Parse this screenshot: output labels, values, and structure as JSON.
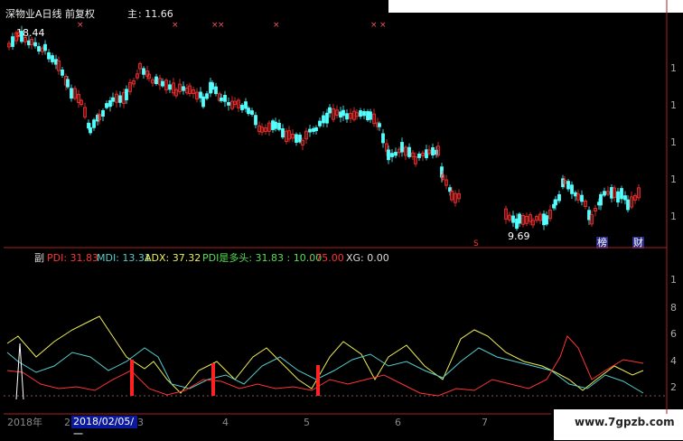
{
  "header": {
    "title": "深物业A日线 前复权",
    "ma_label": "主",
    "ma_value": ": 11.66",
    "high_label": "18.44",
    "low_label": "9.69"
  },
  "markers": {
    "s_label": "S",
    "ban_label": "榜",
    "cai_label": "财",
    "x_mark": "×"
  },
  "price_scale": [
    "1",
    "1",
    "1",
    "1",
    "1",
    "1"
  ],
  "indicator": {
    "name": "副",
    "pdi": "PDI: 31.83",
    "mdi": "MDI: 13.31",
    "adx": "ADX: 37.32",
    "pd_state": "PDI是多头: 31.83 : 10.00",
    "level": ": 75.00",
    "xg": "XG: 0.00",
    "scale": [
      "1",
      "8",
      "6",
      "4",
      "2"
    ]
  },
  "timeline": {
    "year": "2018年",
    "labels": [
      "2",
      "3",
      "4",
      "5",
      "6",
      "7"
    ],
    "cursor_date": "2018/02/05/一"
  },
  "watermark": "www.7gpzb.com",
  "colors": {
    "up": "#ff3333",
    "down": "#55ffff",
    "pdi": "#ff3333",
    "mdi": "#55cccc",
    "adx": "#eeee55",
    "bg": "#000000",
    "grid": "#aa2222"
  }
}
